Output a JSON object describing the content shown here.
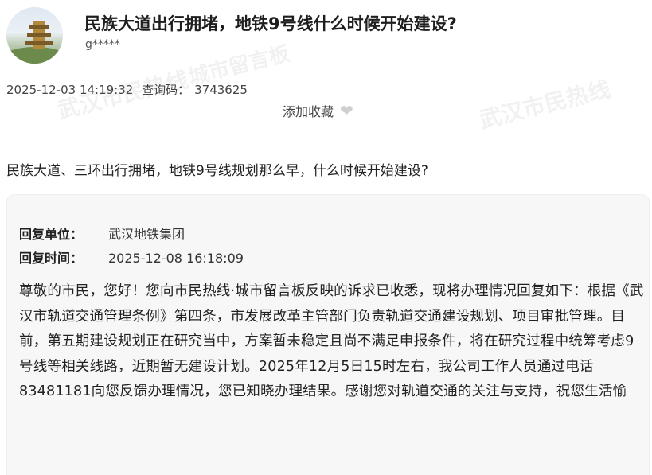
{
  "header": {
    "title": "民族大道出行拥堵，地铁9号线什么时候开始建设?",
    "username": "g*****"
  },
  "meta": {
    "date": "2025-12-03 14:19:32",
    "code_label": "查询码：",
    "code_value": "3743625"
  },
  "favorite": {
    "label": "添加收藏",
    "icon": "heart-icon"
  },
  "question": "民族大道、三环出行拥堵，地铁9号线规划那么早，什么时候开始建设?",
  "reply": {
    "unit_label": "回复单位：",
    "unit_value": "武汉地铁集团",
    "time_label": "回复时间：",
    "time_value": "2025-12-08 16:18:09",
    "body": "尊敬的市民，您好！您向市民热线·城市留言板反映的诉求已收悉，现将办理情况回复如下：根据《武汉市轨道交通管理条例》第四条，市发展改革主管部门负责轨道交通建设规划、项目审批管理。目前，第五期建设规划正在研究当中，方案暂未稳定且尚不满足申报条件，将在研究过程中统筹考虑9号线等相关线路，近期暂无建设计划。2025年12月5日15时左右，我公司工作人员通过电话83481181向您反馈办理情况，您已知晓办理结果。感谢您对轨道交通的关注与支持，祝您生活愉"
  },
  "watermarks": [
    "城市留言板",
    "武汉市民热线",
    "武汉市民热线",
    "城市留言板",
    "武汉市民热线",
    "武汉市民热线"
  ],
  "colors": {
    "heart": "#cfcfcf",
    "card_bg": "#f7f7f7"
  }
}
